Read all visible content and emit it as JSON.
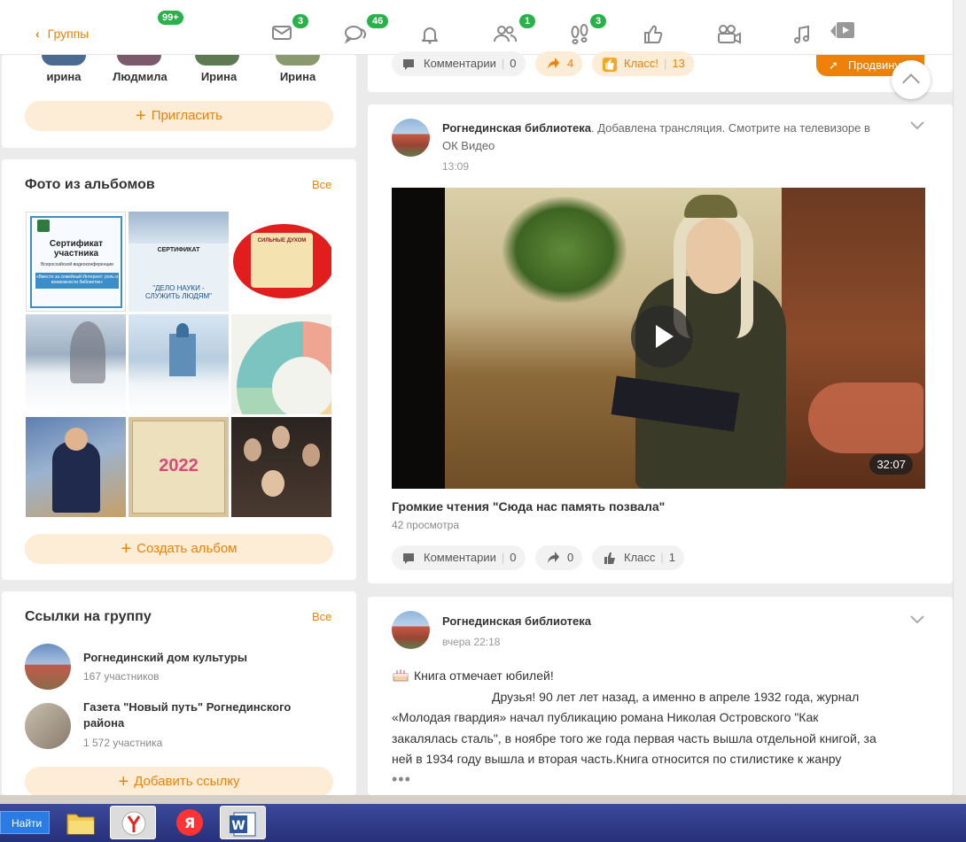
{
  "nav": {
    "back_label": "Группы",
    "groups_badge": "99+",
    "messages_badge": "3",
    "discussions_badge": "46",
    "friends_badge": "1",
    "guests_badge": "3"
  },
  "friends": {
    "names": [
      "ирина",
      "Людмила",
      "Ирина",
      "Ирина"
    ],
    "invite_label": "Пригласить"
  },
  "photos": {
    "title": "Фото из альбомов",
    "all_label": "Все",
    "create_label": "Создать альбом",
    "thumb1": {
      "line1": "Сертификат",
      "line2": "участника",
      "line3": "Всероссийской видеоконференции",
      "line4": "«Вместе за семейный Интернет: роль и возможности библиотек»"
    },
    "thumb2": {
      "line1": "СЕРТИФИКАТ",
      "line2": "\"ДЕЛО НАУКИ -",
      "line3": "СЛУЖИТЬ ЛЮДЯМ\""
    },
    "thumb3": {
      "line1": "СИЛЬНЫЕ ДУХОМ"
    },
    "thumb8": {
      "line1": "2022"
    }
  },
  "links": {
    "title": "Ссылки на группу",
    "all_label": "Все",
    "items": [
      {
        "name": "Рогнединский дом культуры",
        "count": "167 участников"
      },
      {
        "name": "Газета \"Новый путь\" Рогнединского района",
        "count": "1 572 участника"
      }
    ],
    "add_label": "Добавить ссылку"
  },
  "feed1": {
    "comments_label": "Комментарии",
    "comments_count": "0",
    "shares_count": "4",
    "class_label": "Класс!",
    "class_count": "13",
    "promote_label": "Продвинуть"
  },
  "post1": {
    "author": "Рогнединская библиотека",
    "action": ". Добавлена трансляция. Смотрите на телевизоре в ОК Видео",
    "time": "13:09",
    "duration": "32:07",
    "video_title": "Громкие чтения \"Сюда нас память позвала\"",
    "views": "42 просмотра",
    "comments_label": "Комментарии",
    "comments_count": "0",
    "shares_count": "0",
    "class_label": "Класс",
    "class_count": "1"
  },
  "post2": {
    "author": "Рогнединская библиотека",
    "time": "вчера 22:18",
    "line1": "Книга отмечает юбилей!",
    "line2": "Друзья! 90 лет лет назад, а именно в апреле 1932 года,  журнал",
    "line3": "«Молодая гвардия» начал публикацию романа Николая Островского \"Как",
    "line4": "закалялась сталь\", в ноябре того же года первая часть вышла отдельной книгой, за",
    "line5": "ней в 1934 году вышла и вторая часть.Книга относится по стилистике к жанру",
    "more": "•••"
  },
  "taskbar": {
    "start_label": "Найти"
  },
  "colors": {
    "accent": "#ee8208",
    "accent_light": "#fdecd6",
    "badge_green": "#2ab24a",
    "background": "#ebebeb"
  }
}
